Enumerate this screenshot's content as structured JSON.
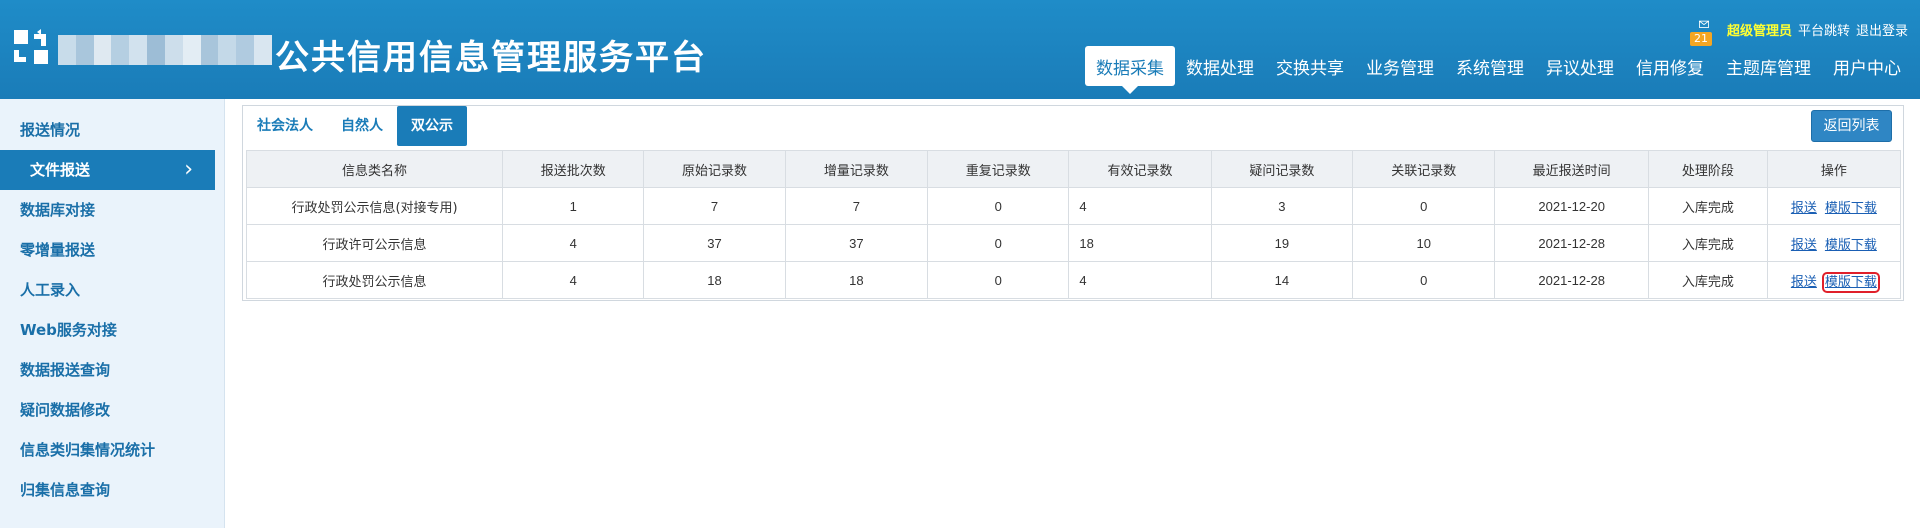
{
  "header": {
    "title": "公共信用信息管理服务平台",
    "mail_count": "21",
    "user_name": "超级管理员",
    "links": [
      "平台跳转",
      "退出登录"
    ],
    "nav": [
      "数据采集",
      "数据处理",
      "交换共享",
      "业务管理",
      "系统管理",
      "异议处理",
      "信用修复",
      "主题库管理",
      "用户中心"
    ],
    "nav_active": "数据采集",
    "colors": {
      "header_bg": "#1a7cb8",
      "username": "#ffff33",
      "badge": "#f5a623"
    }
  },
  "sidebar": {
    "items": [
      "报送情况",
      "文件报送",
      "数据库对接",
      "零增量报送",
      "人工录入",
      "Web服务对接",
      "数据报送查询",
      "疑问数据修改",
      "信息类归集情况统计",
      "归集信息查询"
    ],
    "active": "文件报送"
  },
  "main": {
    "tabs": [
      "社会法人",
      "自然人",
      "双公示"
    ],
    "tab_active": "双公示",
    "back_button": "返回列表",
    "table": {
      "headers": [
        "信息类名称",
        "报送批次数",
        "原始记录数",
        "增量记录数",
        "重复记录数",
        "有效记录数",
        "疑问记录数",
        "关联记录数",
        "最近报送时间",
        "处理阶段",
        "操作"
      ],
      "rows": [
        {
          "name": "行政处罚公示信息(对接专用)",
          "batches": "1",
          "original": "7",
          "incremental": "7",
          "duplicate": "0",
          "valid": "4",
          "questionable": "3",
          "linked": "0",
          "last_time": "2021-12-20",
          "stage": "入库完成",
          "op_submit": "报送",
          "op_download": "模版下载"
        },
        {
          "name": "行政许可公示信息",
          "batches": "4",
          "original": "37",
          "incremental": "37",
          "duplicate": "0",
          "valid": "18",
          "questionable": "19",
          "linked": "10",
          "last_time": "2021-12-28",
          "stage": "入库完成",
          "op_submit": "报送",
          "op_download": "模版下载"
        },
        {
          "name": "行政处罚公示信息",
          "batches": "4",
          "original": "18",
          "incremental": "18",
          "duplicate": "0",
          "valid": "4",
          "questionable": "14",
          "linked": "0",
          "last_time": "2021-12-28",
          "stage": "入库完成",
          "op_submit": "报送",
          "op_download": "模版下载"
        }
      ]
    }
  }
}
